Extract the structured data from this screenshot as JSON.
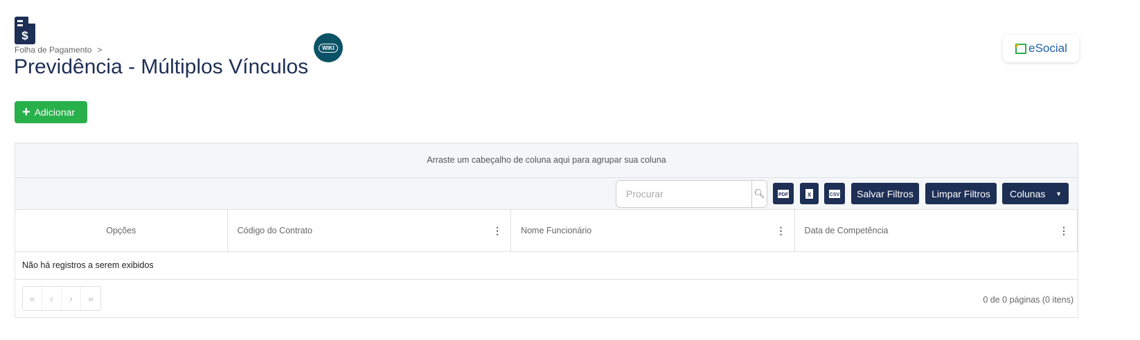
{
  "header": {
    "breadcrumb": "Folha de Pagamento",
    "breadcrumb_sep": ">",
    "title": "Previdência - Múltiplos Vínculos",
    "wiki_label": "WIKI",
    "esocial_label": "eSocial"
  },
  "actions": {
    "add_label": "Adicionar"
  },
  "grid": {
    "group_hint": "Arraste um cabeçalho de coluna aqui para agrupar sua coluna",
    "search": {
      "placeholder": "Procurar",
      "value": ""
    },
    "export": {
      "pdf": "PDF",
      "excel": "X",
      "csv": "CSV"
    },
    "toolbar": {
      "save_filters": "Salvar Filtros",
      "clear_filters": "Limpar Filtros",
      "columns": "Colunas"
    },
    "columns": [
      "Opções",
      "Código do Contrato",
      "Nome Funcionário",
      "Data de Competência"
    ],
    "empty_message": "Não há registros a serem exibidos",
    "pager": {
      "first": "«",
      "prev": "‹",
      "next": "›",
      "last": "»",
      "info": "0 de 0 páginas (0 itens)"
    }
  },
  "colors": {
    "primary": "#1e2f55",
    "success": "#28b04b",
    "wiki": "#0b5266"
  }
}
